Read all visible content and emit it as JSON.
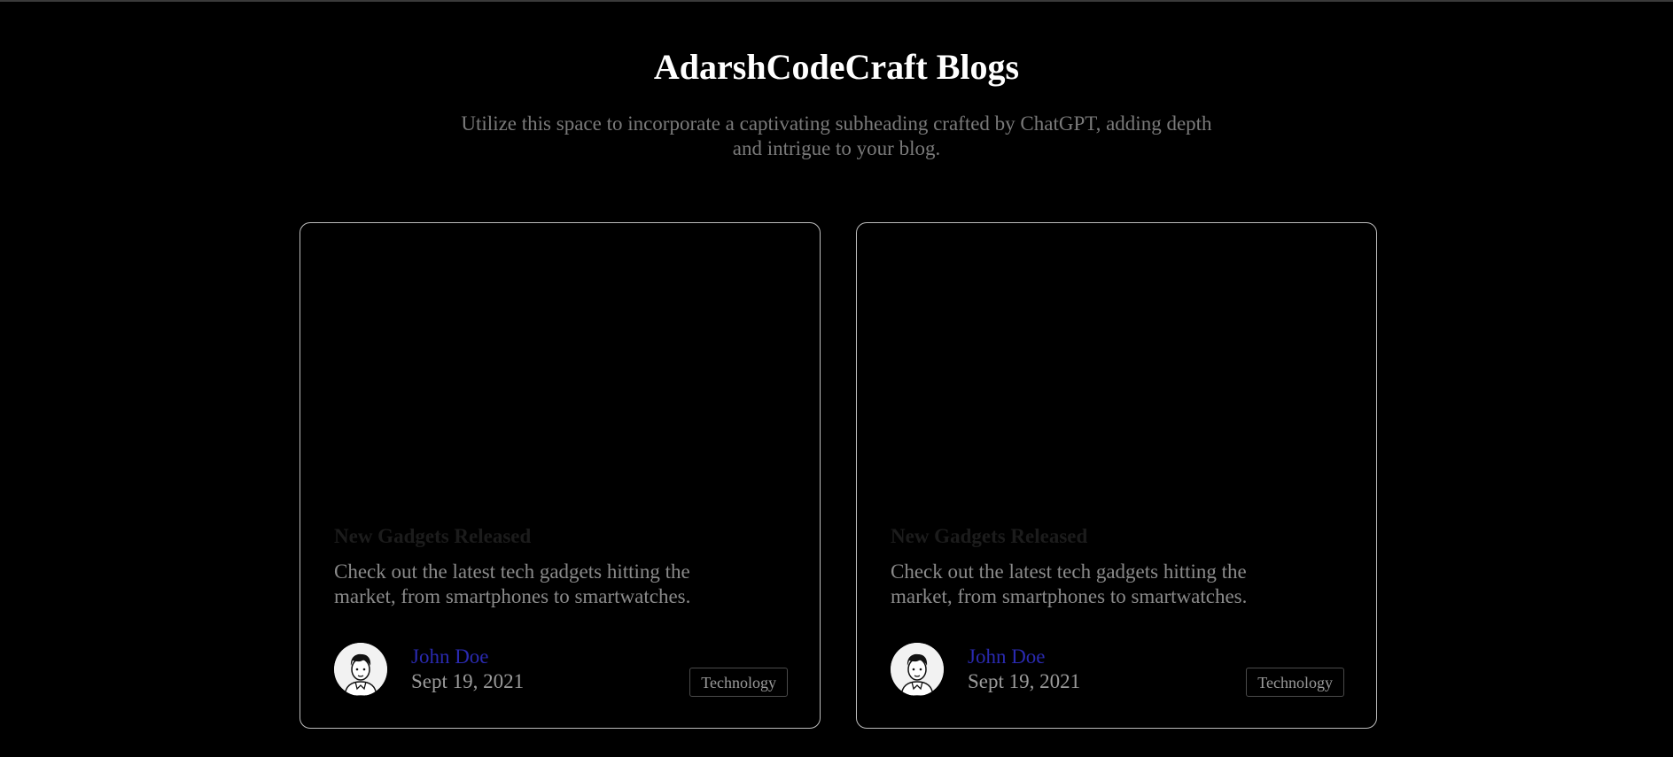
{
  "header": {
    "title": "AdarshCodeCraft Blogs",
    "subtitle": "Utilize this space to incorporate a captivating subheading crafted by ChatGPT, adding depth and intrigue to your blog."
  },
  "cards": [
    {
      "title": "New Gadgets Released",
      "description": "Check out the latest tech gadgets hitting the market, from smartphones to smartwatches.",
      "author": "John Doe",
      "date": "Sept 19, 2021",
      "tag": "Technology",
      "avatar_icon": "person-avatar-icon"
    },
    {
      "title": "New Gadgets Released",
      "description": "Check out the latest tech gadgets hitting the market, from smartphones to smartwatches.",
      "author": "John Doe",
      "date": "Sept 19, 2021",
      "tag": "Technology",
      "avatar_icon": "person-avatar-icon"
    }
  ],
  "colors": {
    "background": "#000000",
    "title": "#ffffff",
    "subtitle": "#7a7a7a",
    "card_border": "#bdbdbd",
    "author_link": "#2a2ab0",
    "muted_text": "#9a9a9a"
  }
}
